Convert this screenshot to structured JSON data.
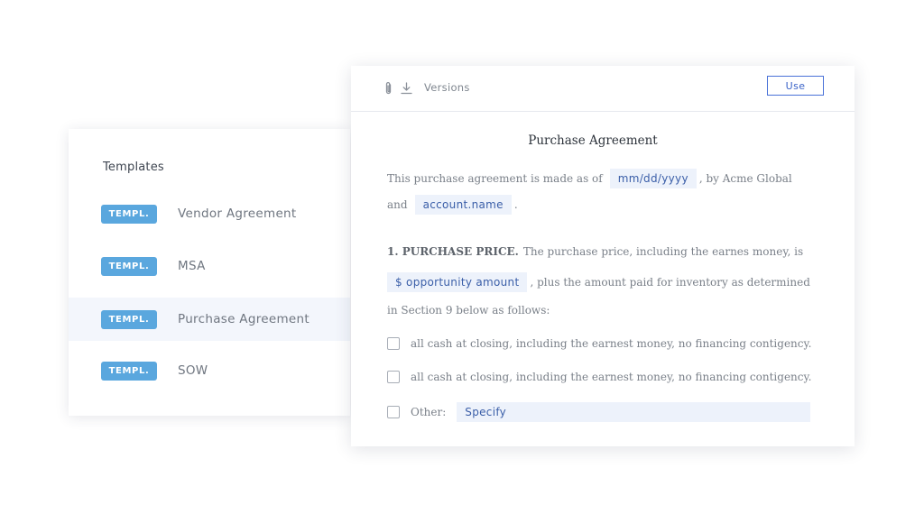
{
  "templates": {
    "title": "Templates",
    "badge_label": "TEMPL.",
    "items": [
      {
        "name": "Vendor Agreement",
        "selected": false
      },
      {
        "name": "MSA",
        "selected": false
      },
      {
        "name": "Purchase Agreement",
        "selected": true
      },
      {
        "name": "SOW",
        "selected": false
      }
    ]
  },
  "toolbar": {
    "attach_icon": "paperclip-icon",
    "download_icon": "download-icon",
    "versions_label": "Versions",
    "use_label": "Use"
  },
  "document": {
    "title": "Purchase Agreement",
    "intro_prefix": "This purchase agreement is made as of",
    "date_field": "mm/dd/yyyy",
    "intro_suffix": ", by Acme Global",
    "and_label": "and",
    "account_field": "account.name",
    "period": ".",
    "section_heading": "1. PURCHASE PRICE.",
    "section_text": "The purchase price, including the earnes money, is",
    "amount_field": "$ opportunity amount",
    "amount_suffix": ", plus the amount paid for inventory as determined",
    "section_continued": "in Section 9 below as follows:",
    "options": [
      "all cash at closing, including the earnest money, no financing contigency.",
      "all cash at closing, including the earnest money, no financing contigency."
    ],
    "other_label": "Other:",
    "specify_value": "Specify"
  },
  "colors": {
    "badge": "#5aa7de",
    "field_bg": "#edf2fb",
    "accent": "#4a72d8",
    "selected_row": "#f3f6fc"
  }
}
